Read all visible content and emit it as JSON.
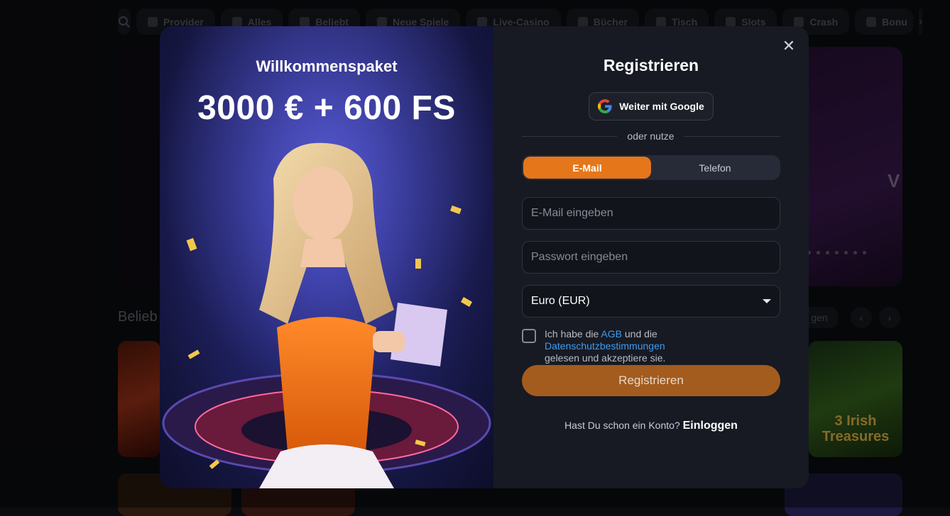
{
  "categories": {
    "provider_label": "Provider",
    "items": [
      {
        "label": "Alles",
        "icon": "cherries-icon"
      },
      {
        "label": "Beliebt",
        "icon": "flame-icon"
      },
      {
        "label": "Neue Spiele",
        "icon": "new-badge-icon"
      },
      {
        "label": "Live-Casino",
        "icon": "live-chip-icon"
      },
      {
        "label": "Bücher",
        "icon": "book-icon"
      },
      {
        "label": "Tisch",
        "icon": "cards-icon"
      },
      {
        "label": "Slots",
        "icon": "slot-machine-icon"
      },
      {
        "label": "Crash",
        "icon": "plane-icon"
      },
      {
        "label": "Bonu",
        "icon": "diamond-icon"
      }
    ]
  },
  "hero": {
    "partial_text": "V"
  },
  "section": {
    "title": "Belieb",
    "more_label": "gen"
  },
  "game_card_right": {
    "title": "3 Irish Treasures"
  },
  "promo": {
    "title": "Willkommenspaket",
    "amount": "3000 € + 600 FS"
  },
  "form": {
    "title": "Registrieren",
    "google_label": "Weiter mit Google",
    "or_label": "oder nutze",
    "tabs": [
      {
        "label": "E-Mail",
        "active": true
      },
      {
        "label": "Telefon",
        "active": false
      }
    ],
    "email_placeholder": "E-Mail eingeben",
    "password_placeholder": "Passwort eingeben",
    "currency_value": "Euro (EUR)",
    "terms_prefix": "Ich habe die ",
    "terms_agb": "AGB",
    "terms_mid": " und die ",
    "terms_privacy": "Datenschutzbestimmungen",
    "terms_suffix": "gelesen und akzeptiere sie.",
    "submit_label": "Registrieren",
    "login_prompt": "Hast Du schon ein Konto?",
    "login_link": "Einloggen"
  },
  "colors": {
    "accent": "#e5761a",
    "link": "#3d9bf0",
    "modal_bg": "#171a23"
  }
}
